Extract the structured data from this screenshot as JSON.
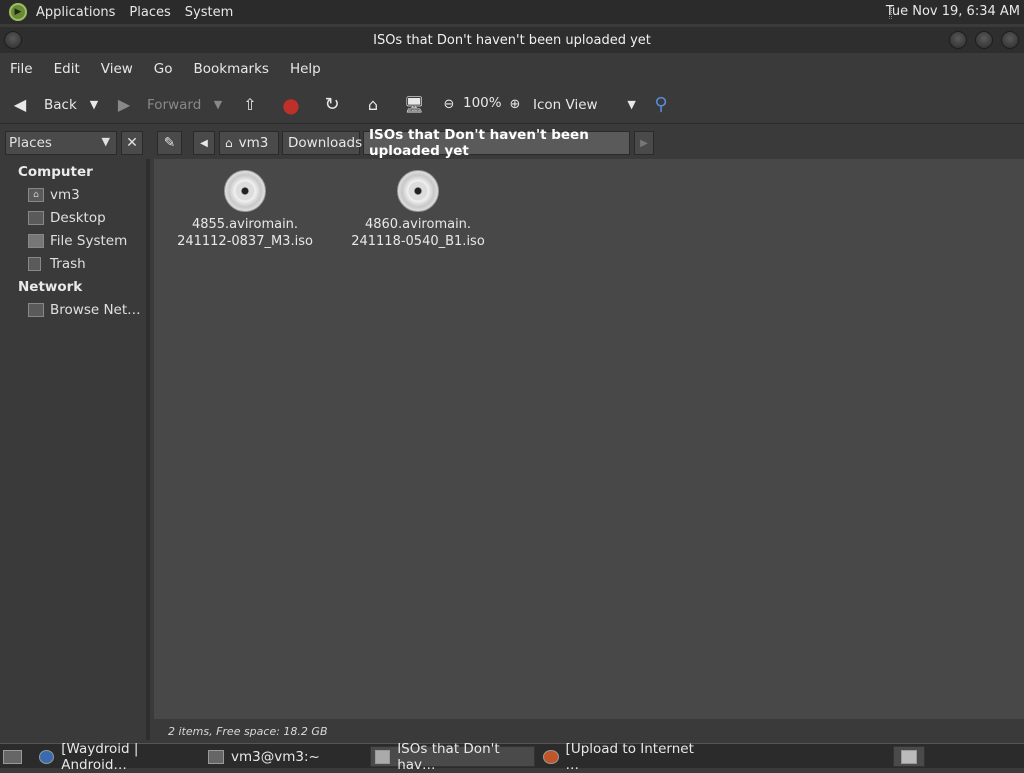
{
  "panel": {
    "menus": [
      "Applications",
      "Places",
      "System"
    ],
    "clock": "Tue Nov 19,  6:34 AM"
  },
  "window": {
    "title": "ISOs that Don't haven't been uploaded yet"
  },
  "menubar": [
    "File",
    "Edit",
    "View",
    "Go",
    "Bookmarks",
    "Help"
  ],
  "toolbar": {
    "back": "Back",
    "forward": "Forward",
    "zoom": "100%",
    "view_mode": "Icon View"
  },
  "pathbar": {
    "side_pane": "Places",
    "crumbs": [
      "vm3",
      "Downloads",
      "ISOs that Don't haven't been uploaded yet"
    ]
  },
  "sidebar": {
    "computer_heading": "Computer",
    "computer_items": [
      "vm3",
      "Desktop",
      "File System",
      "Trash"
    ],
    "network_heading": "Network",
    "network_items": [
      "Browse Net…"
    ]
  },
  "files": [
    {
      "line1": "4855.aviromain.",
      "line2": "241112-0837_M3.iso"
    },
    {
      "line1": "4860.aviromain.",
      "line2": "241118-0540_B1.iso"
    }
  ],
  "status": "2 items, Free space: 18.2 GB",
  "taskbar": [
    "[Waydroid | Android…",
    "vm3@vm3:~",
    "ISOs that Don't hav…",
    "[Upload to Internet …"
  ]
}
